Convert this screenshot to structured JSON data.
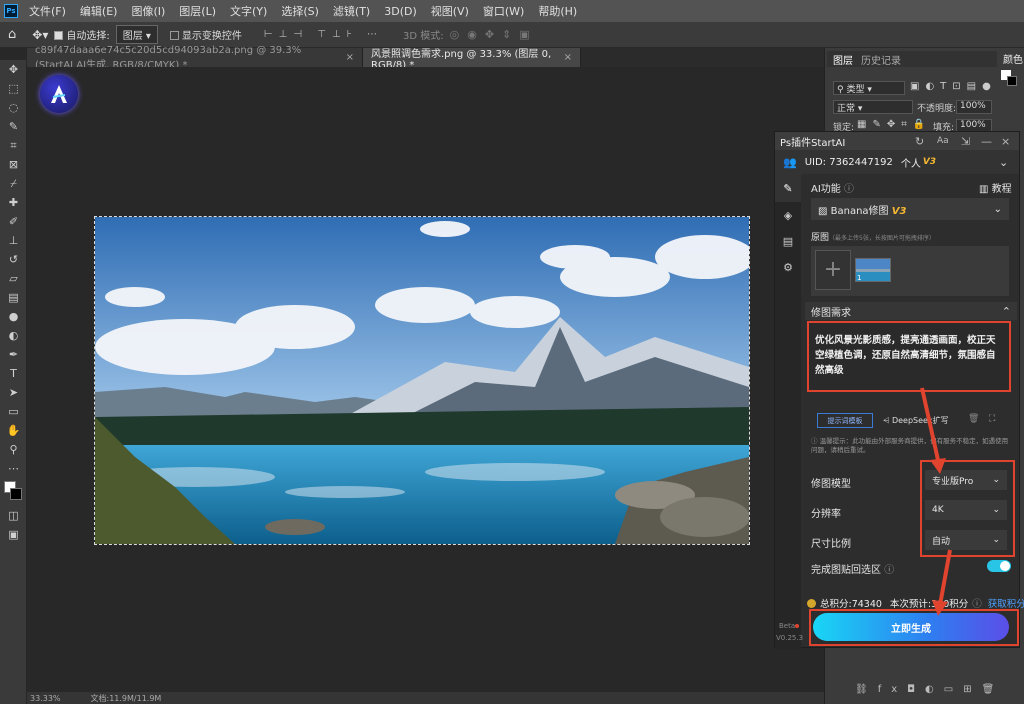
{
  "app": {
    "logo": "Ps"
  },
  "menu": [
    "文件(F)",
    "编辑(E)",
    "图像(I)",
    "图层(L)",
    "文字(Y)",
    "选择(S)",
    "滤镜(T)",
    "3D(D)",
    "视图(V)",
    "窗口(W)",
    "帮助(H)"
  ],
  "options": {
    "auto_select": "自动选择:",
    "layer_value": "图层",
    "show_transform": "显示变换控件",
    "mode_3d": "3D 模式:"
  },
  "tabs": [
    {
      "label": "c89f47daaa6e74c5c20d5cd94093ab2a.png @ 39.3% (StartAI AI生成, RGB/8/CMYK) *"
    },
    {
      "label": "风景照调色需求.png @ 33.3% (图层 0, RGB/8) *"
    }
  ],
  "status": {
    "zoom": "33.33%",
    "doc": "文档:11.9M/11.9M"
  },
  "layers_panel": {
    "tab_layers": "图层",
    "tab_history": "历史记录",
    "filter": "类型",
    "blend": "正常",
    "opacity_label": "不透明度:",
    "opacity": "100%",
    "lock_label": "锁定:",
    "fill_label": "填充:",
    "fill": "100%",
    "color_tab": "颜色"
  },
  "plugin": {
    "title": "Ps插件StartAI",
    "uid": "UID: 7362447192",
    "account_type": "个人",
    "vip_badge": "V3",
    "ai_function_label": "AI功能",
    "tutorial": "教程",
    "function_select": "Banana修图",
    "function_badge": "V3",
    "source_label": "原图",
    "source_hint": "（最多上传5张，长按图片可拖拽排序）",
    "thumb_index": "1",
    "request_label": "修图需求",
    "request_text": "优化风景光影质感，提亮通透画面，校正天空绿植色调，还原自然高清细节，氛围感自然高级",
    "prompt_template_btn": "提示词模板",
    "deepseek_btn": "DeepSeek扩写",
    "notice": "温馨提示：此功能由外部服务商提供，偶有服务不稳定，如遇使用问题，请稍后重试。",
    "model_label": "修图模型",
    "model_value": "专业版Pro",
    "resolution_label": "分辨率",
    "resolution_value": "4K",
    "ratio_label": "尺寸比例",
    "ratio_value": "自动",
    "paste_back_label": "完成图贴回选区",
    "points_total": "总积分:74340",
    "points_estimate": "本次预计:300积分",
    "get_points": "获取积分",
    "generate_btn": "立即生成",
    "beta": "Beta",
    "version": "V0.25.3"
  }
}
